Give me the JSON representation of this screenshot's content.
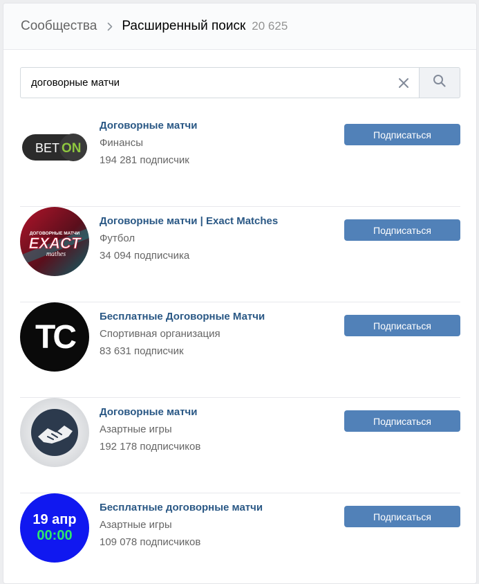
{
  "header": {
    "root": "Сообщества",
    "current": "Расширенный поиск",
    "count": "20 625"
  },
  "search": {
    "value": "договорные матчи",
    "clear_icon": "close-icon",
    "button_icon": "search-icon"
  },
  "colors": {
    "link": "#2a5885",
    "button": "#5181b8",
    "muted": "#656565"
  },
  "results": [
    {
      "name": "Договорные матчи",
      "category": "Финансы",
      "subscribers": "194 281 подписчик",
      "button": "Подписаться",
      "avatar_icon": "bet-on-logo",
      "avatar_text": [
        "BET",
        "ON"
      ]
    },
    {
      "name": "Договорные матчи | Exact Matches",
      "category": "Футбол",
      "subscribers": "34 094 подписчика",
      "button": "Подписаться",
      "avatar_icon": "exact-matches-logo",
      "avatar_text": [
        "ДОГОВОРНЫЕ МАТЧИ",
        "EXACT",
        "mathes"
      ]
    },
    {
      "name": "Бесплатные Договорные Матчи",
      "category": "Спортивная организация",
      "subscribers": "83 631 подписчик",
      "button": "Подписаться",
      "avatar_icon": "tc-logo",
      "avatar_text": [
        "TC"
      ]
    },
    {
      "name": "Договорные матчи",
      "category": "Азартные игры",
      "subscribers": "192 178 подписчиков",
      "button": "Подписаться",
      "avatar_icon": "handshake-logo"
    },
    {
      "name": "Бесплатные договорные матчи",
      "category": "Азартные игры",
      "subscribers": "109 078 подписчиков",
      "button": "Подписаться",
      "avatar_icon": "date-logo",
      "avatar_text": [
        "19 апр",
        "00:00"
      ]
    }
  ]
}
